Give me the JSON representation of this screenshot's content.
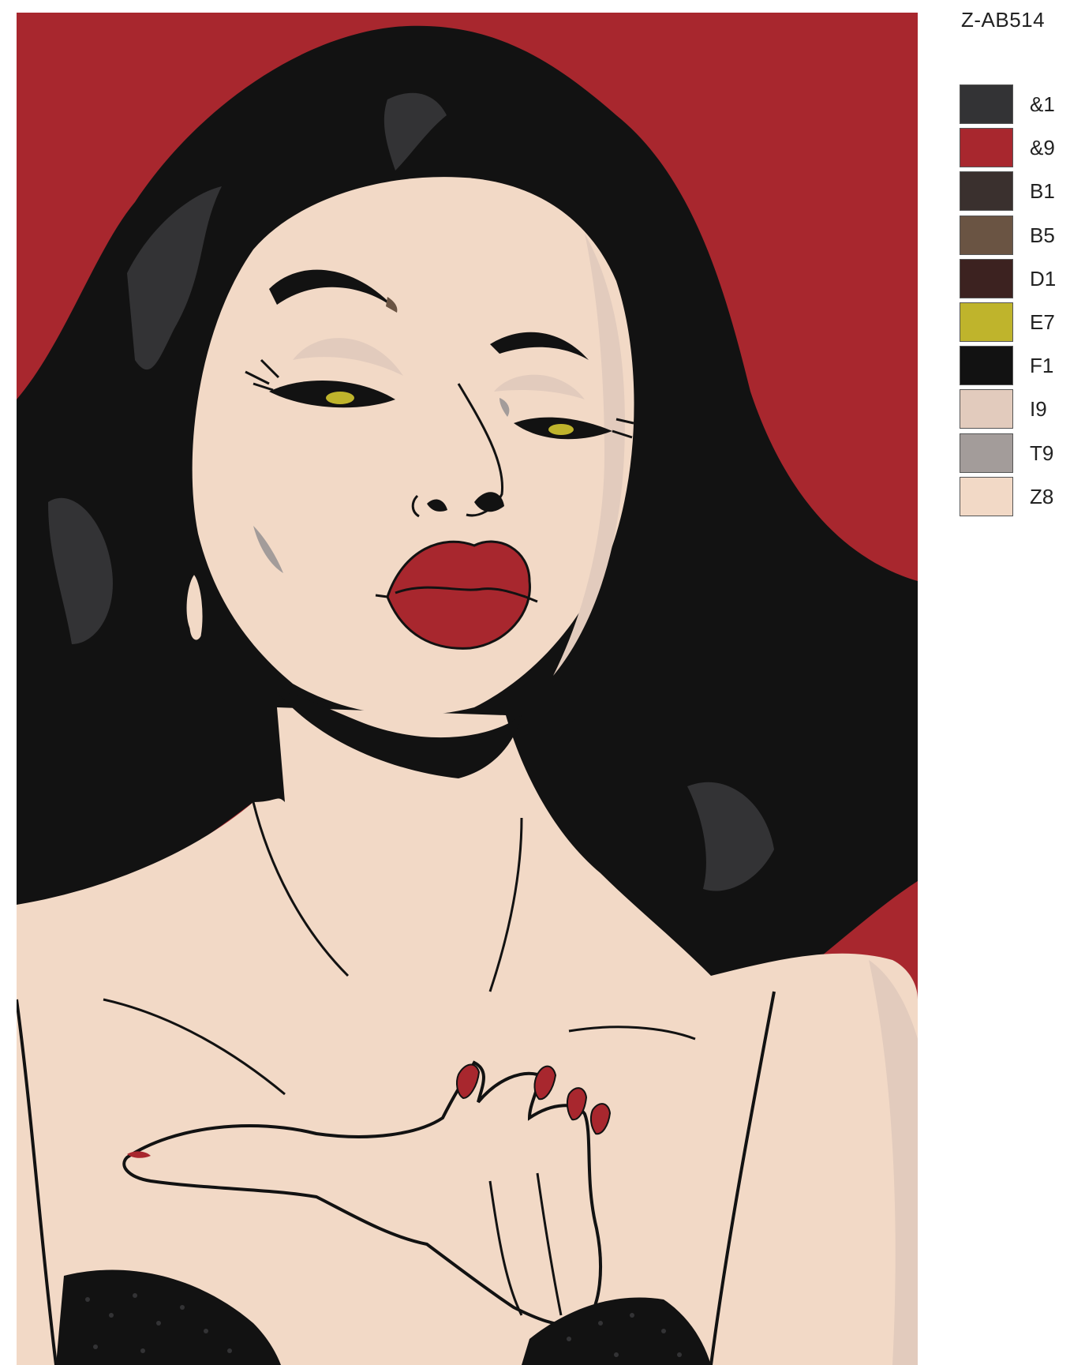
{
  "code": "Z-AB514",
  "palette": [
    {
      "code": "&1",
      "color": "#333335"
    },
    {
      "code": "&9",
      "color": "#a8272e"
    },
    {
      "code": "B1",
      "color": "#3a302e"
    },
    {
      "code": "B5",
      "color": "#6a5443"
    },
    {
      "code": "D1",
      "color": "#3c2220"
    },
    {
      "code": "E7",
      "color": "#bfb42c"
    },
    {
      "code": "F1",
      "color": "#121212"
    },
    {
      "code": "I9",
      "color": "#e2cbbd"
    },
    {
      "code": "T9",
      "color": "#a39c9a"
    },
    {
      "code": "Z8",
      "color": "#f2d9c6"
    }
  ]
}
